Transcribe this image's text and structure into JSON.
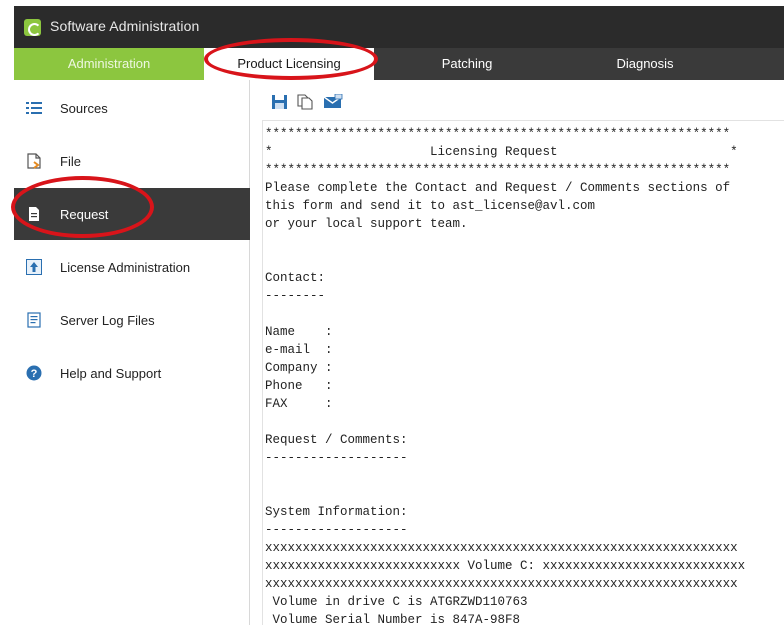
{
  "window": {
    "title": "Software Administration"
  },
  "tabs": [
    {
      "label": "Administration"
    },
    {
      "label": "Product Licensing"
    },
    {
      "label": "Patching"
    },
    {
      "label": "Diagnosis"
    }
  ],
  "sidebar": {
    "items": [
      {
        "label": "Sources",
        "icon": "list-icon"
      },
      {
        "label": "File",
        "icon": "file-icon"
      },
      {
        "label": "Request",
        "icon": "document-icon"
      },
      {
        "label": "License Administration",
        "icon": "upload-icon"
      },
      {
        "label": "Server Log Files",
        "icon": "log-file-icon"
      },
      {
        "label": "Help and Support",
        "icon": "help-icon"
      }
    ]
  },
  "toolbar": {
    "icons": [
      "save-icon",
      "copy-icon",
      "email-icon"
    ]
  },
  "request_text": {
    "lines": [
      "**************************************************************",
      "*                     Licensing Request                       *",
      "**************************************************************",
      "Please complete the Contact and Request / Comments sections of",
      "this form and send it to ast_license@avl.com",
      "or your local support team.",
      "",
      "",
      "Contact:",
      "--------",
      "",
      "Name    :",
      "e-mail  :",
      "Company :",
      "Phone   :",
      "FAX     :",
      "",
      "Request / Comments:",
      "-------------------",
      "",
      "",
      "System Information:",
      "-------------------",
      "xxxxxxxxxxxxxxxxxxxxxxxxxxxxxxxxxxxxxxxxxxxxxxxxxxxxxxxxxxxxxxx",
      "xxxxxxxxxxxxxxxxxxxxxxxxxx Volume C: xxxxxxxxxxxxxxxxxxxxxxxxxxx",
      "xxxxxxxxxxxxxxxxxxxxxxxxxxxxxxxxxxxxxxxxxxxxxxxxxxxxxxxxxxxxxxx",
      " Volume in drive C is ATGRZWD110763",
      " Volume Serial Number is 847A-98F8"
    ]
  },
  "colors": {
    "accent": "#8cc63f",
    "annotation": "#d8141a"
  }
}
